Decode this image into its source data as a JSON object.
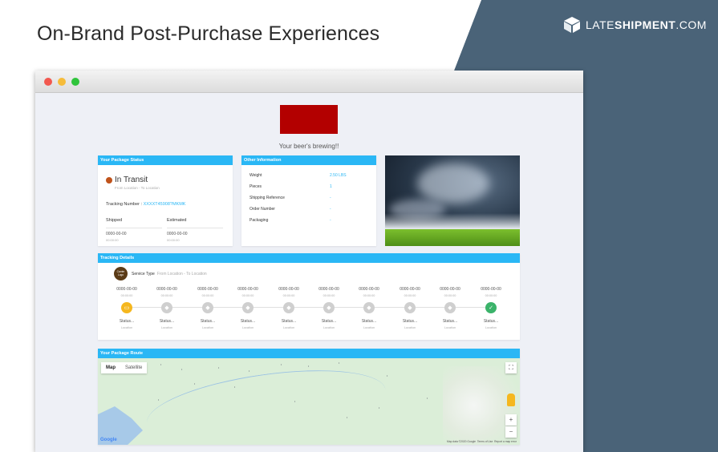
{
  "header": {
    "title": "On-Brand Post-Purchase Experiences",
    "brand_prefix": "LATE",
    "brand_bold": "SHIPMENT",
    "brand_suffix": ".COM",
    "brand_color": "#4a6378"
  },
  "page": {
    "tagline": "Your beer's brewing!!",
    "accent_color": "#2ab7f5",
    "logo_color": "#b30000"
  },
  "package_status": {
    "heading": "Your Package Status",
    "status": "In Transit",
    "route": "From Location - To Location",
    "tracking_label": "Tracking Number :",
    "tracking_number": "XXXXT45908?MKMK",
    "shipped_label": "Shipped",
    "estimated_label": "Estimated",
    "shipped_date": "0000-00-00",
    "shipped_time": "00:00:00",
    "estimated_date": "0000-00-00",
    "estimated_time": "00:00:00"
  },
  "other_info": {
    "heading": "Other Information",
    "rows": [
      {
        "label": "Weight",
        "value": "2.50 LBS"
      },
      {
        "label": "Pieces",
        "value": "1"
      },
      {
        "label": "Shipping Reference",
        "value": "-"
      },
      {
        "label": "Order Number",
        "value": "-"
      },
      {
        "label": "Packaging",
        "value": "-"
      }
    ]
  },
  "tracking": {
    "heading": "Tracking Details",
    "carrier_logo": "Carrier Logo",
    "service_label": "Service Type",
    "service_route": "From Location - To Location",
    "steps": [
      {
        "date": "0000-00-00",
        "time": "00:00:00",
        "status": "Status...",
        "location": "Location",
        "icon": "truck-icon"
      },
      {
        "date": "0000-00-00",
        "time": "00:00:00",
        "status": "Status...",
        "location": "Location",
        "icon": "box-icon"
      },
      {
        "date": "0000-00-00",
        "time": "00:00:00",
        "status": "Status...",
        "location": "Location",
        "icon": "box-icon"
      },
      {
        "date": "0000-00-00",
        "time": "00:00:00",
        "status": "Status...",
        "location": "Location",
        "icon": "box-icon"
      },
      {
        "date": "0000-00-00",
        "time": "00:00:00",
        "status": "Status...",
        "location": "Location",
        "icon": "box-icon"
      },
      {
        "date": "0000-00-00",
        "time": "00:00:00",
        "status": "Status...",
        "location": "Location",
        "icon": "box-icon"
      },
      {
        "date": "0000-00-00",
        "time": "00:00:00",
        "status": "Status...",
        "location": "Location",
        "icon": "box-icon"
      },
      {
        "date": "0000-00-00",
        "time": "00:00:00",
        "status": "Status...",
        "location": "Location",
        "icon": "box-icon"
      },
      {
        "date": "0000-00-00",
        "time": "00:00:00",
        "status": "Status...",
        "location": "Location",
        "icon": "box-icon"
      },
      {
        "date": "0000-00-00",
        "time": "00:00:00",
        "status": "Status...",
        "location": "Location",
        "icon": "delivered-icon"
      }
    ]
  },
  "route": {
    "heading": "Your Package Route",
    "map_tab": "Map",
    "satellite_tab": "Satellite",
    "google_label": "Google",
    "map_data": "Map data ©2020 Google",
    "terms": "Terms of Use",
    "report": "Report a map error"
  }
}
